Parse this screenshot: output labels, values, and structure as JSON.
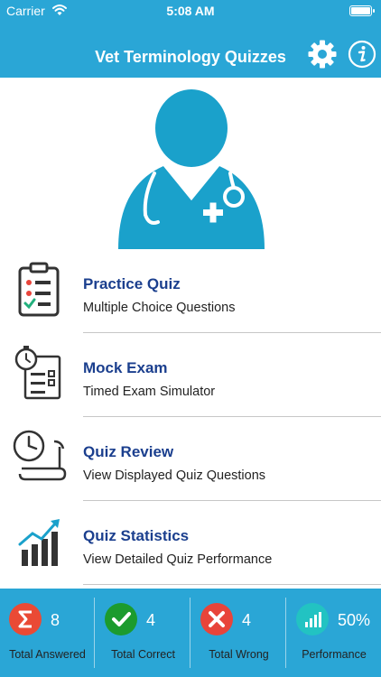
{
  "status_bar": {
    "carrier": "Carrier",
    "time": "5:08 AM"
  },
  "nav": {
    "title": "Vet Terminology Quizzes"
  },
  "menu": [
    {
      "title": "Practice Quiz",
      "subtitle": "Multiple Choice Questions",
      "icon": "clipboard-checklist-icon"
    },
    {
      "title": "Mock Exam",
      "subtitle": "Timed Exam Simulator",
      "icon": "stopwatch-checklist-icon"
    },
    {
      "title": "Quiz Review",
      "subtitle": "View Displayed Quiz Questions",
      "icon": "clock-scroll-icon"
    },
    {
      "title": "Quiz Statistics",
      "subtitle": "View Detailed Quiz Performance",
      "icon": "bar-chart-icon"
    }
  ],
  "stats": [
    {
      "value": "8",
      "label": "Total Answered",
      "color": "#ea4a35",
      "icon": "sigma-icon"
    },
    {
      "value": "4",
      "label": "Total Correct",
      "color": "#1c9b2e",
      "icon": "check-icon"
    },
    {
      "value": "4",
      "label": "Total Wrong",
      "color": "#e8443a",
      "icon": "x-icon"
    },
    {
      "value": "50%",
      "label": "Performance",
      "color": "#22c3c2",
      "icon": "bar-chart-icon"
    }
  ],
  "colors": {
    "primary": "#2aa6d6",
    "title_text": "#1b3f8e"
  }
}
